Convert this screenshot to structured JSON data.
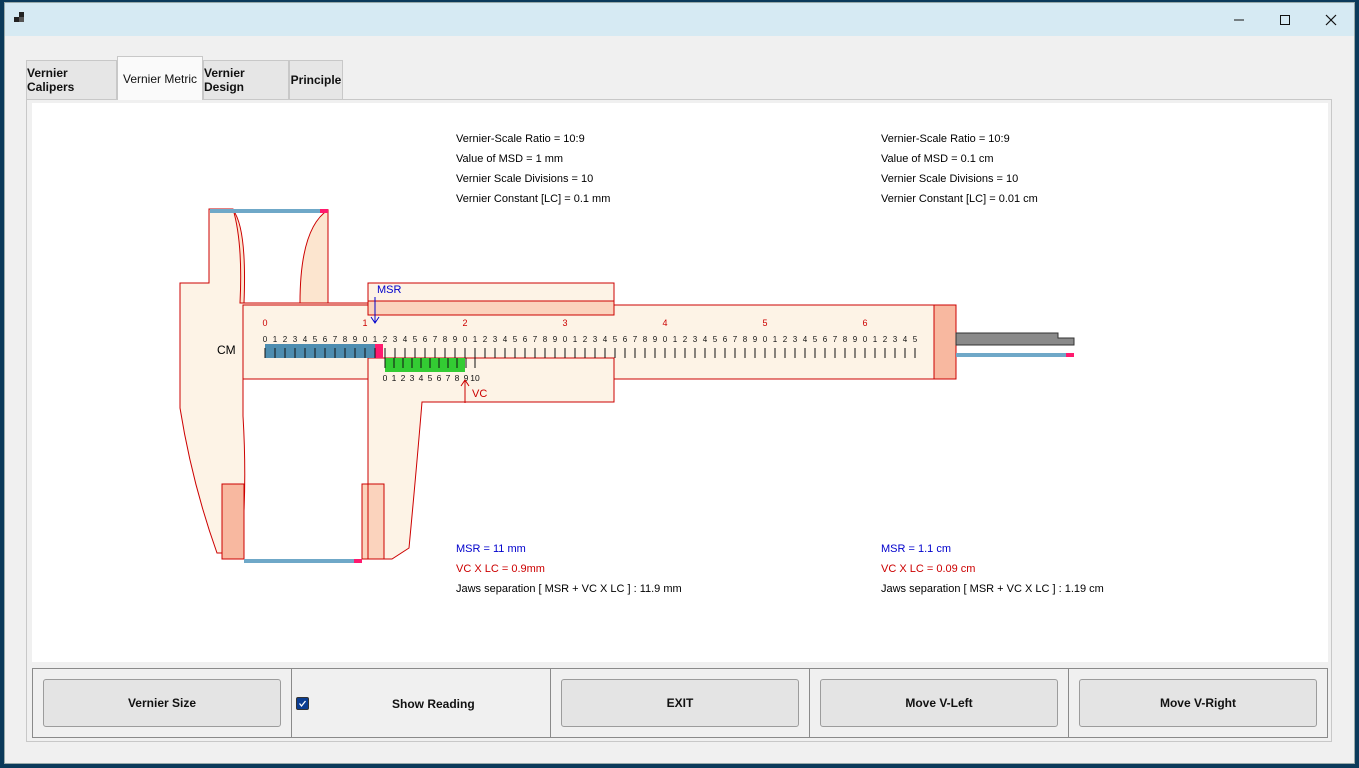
{
  "window": {
    "controls": {
      "minimize_icon": "minimize-icon",
      "maximize_icon": "maximize-icon",
      "close_icon": "close-icon"
    }
  },
  "tabs": [
    {
      "label": "Vernier Calipers",
      "active": false
    },
    {
      "label": "Vernier Metric",
      "active": true
    },
    {
      "label": "Vernier Design",
      "active": false
    },
    {
      "label": "Principle",
      "active": false
    }
  ],
  "info_mm": {
    "ratio": "Vernier-Scale Ratio = 10:9",
    "msd": "Value of MSD = 1 mm",
    "divisions": "Vernier Scale Divisions = 10",
    "lc": "Vernier Constant [LC] = 0.1 mm"
  },
  "info_cm": {
    "ratio": "Vernier-Scale Ratio = 10:9",
    "msd": "Value of MSD = 0.1 cm",
    "divisions": "Vernier Scale Divisions = 10",
    "lc": "Vernier Constant [LC] = 0.01 cm"
  },
  "reading_mm": {
    "msr": "MSR = 11 mm",
    "vc": "VC X LC = 0.9mm",
    "jaws": "Jaws separation [ MSR + VC X LC ] : 11.9 mm"
  },
  "reading_cm": {
    "msr": "MSR = 1.1 cm",
    "vc": "VC X LC = 0.09 cm",
    "jaws": "Jaws separation [ MSR + VC X LC ] : 1.19 cm"
  },
  "caliper": {
    "unit_label": "CM",
    "msr_marker": "MSR",
    "vc_marker": "VC",
    "main_scale_cm": [
      "0",
      "1",
      "2",
      "3",
      "4",
      "5",
      "6"
    ],
    "main_scale_mm_digits": [
      "0",
      "1",
      "2",
      "3",
      "4",
      "5",
      "6",
      "7",
      "8",
      "9"
    ],
    "main_scale_last_digits": [
      "0",
      "1",
      "2",
      "3",
      "4",
      "5"
    ],
    "vernier_labels": [
      "0",
      "1",
      "2",
      "3",
      "4",
      "5",
      "6",
      "7",
      "8",
      "9",
      "10"
    ],
    "colors": {
      "body": "#fdf3e6",
      "jaw_tip": "#f8b8a0",
      "outline": "#cc0000",
      "main_fill": "#4e8db0",
      "vernier_fill": "#33cc33",
      "marker": "#ff1a6e",
      "rod": "#6fa8c8",
      "depth_bar": "#8a8a8a"
    },
    "reading": {
      "main_scale_cm": 1.1,
      "vernier_coincidence": 9
    }
  },
  "buttons": {
    "vernier_size": "Vernier Size",
    "show_reading": "Show Reading",
    "show_reading_checked": true,
    "exit": "EXIT",
    "move_left": "Move V-Left",
    "move_right": "Move V-Right"
  }
}
